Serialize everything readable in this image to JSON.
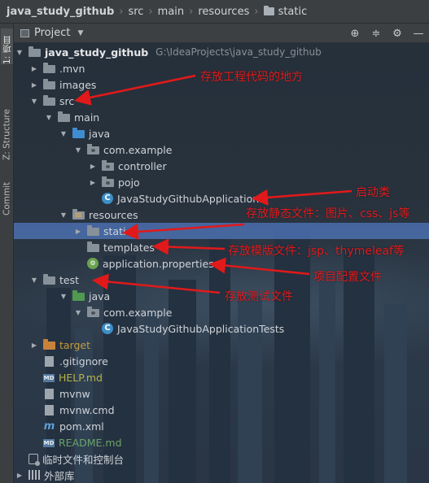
{
  "breadcrumb": [
    {
      "label": "java_study_github",
      "bold": true,
      "icon": "none"
    },
    {
      "label": "src",
      "icon": "none"
    },
    {
      "label": "main",
      "icon": "none"
    },
    {
      "label": "resources",
      "icon": "none"
    },
    {
      "label": "static",
      "icon": "folder-icon"
    }
  ],
  "sidebar": {
    "tabs": [
      "1: 项目",
      "Z: Structure",
      "Commit"
    ]
  },
  "panel": {
    "title": "Project",
    "tools": [
      "locate-icon",
      "collapse-icon",
      "gear-icon",
      "hide-icon"
    ]
  },
  "tree": [
    {
      "label": "java_study_github",
      "hint": "G:\\IdeaProjects\\java_study_github",
      "arrow": "open",
      "icon": "module",
      "style": "bold"
    },
    {
      "label": ".mvn",
      "arrow": "closed",
      "icon": "folder"
    },
    {
      "label": "images",
      "arrow": "closed",
      "icon": "folder"
    },
    {
      "label": "src",
      "arrow": "open",
      "icon": "folder"
    },
    {
      "label": "main",
      "arrow": "open",
      "icon": "folder"
    },
    {
      "label": "java",
      "arrow": "open",
      "icon": "folder-blue"
    },
    {
      "label": "com.example",
      "arrow": "open",
      "icon": "package"
    },
    {
      "label": "controller",
      "arrow": "closed",
      "icon": "package"
    },
    {
      "label": "pojo",
      "arrow": "closed",
      "icon": "package"
    },
    {
      "label": "JavaStudyGithubApplication",
      "arrow": "none",
      "icon": "class"
    },
    {
      "label": "resources",
      "arrow": "open",
      "icon": "folder-resources"
    },
    {
      "label": "static",
      "arrow": "closed",
      "icon": "folder",
      "selected": true
    },
    {
      "label": "templates",
      "arrow": "none",
      "icon": "folder"
    },
    {
      "label": "application.properties",
      "arrow": "none",
      "icon": "properties"
    },
    {
      "label": "test",
      "arrow": "open",
      "icon": "folder"
    },
    {
      "label": "java",
      "arrow": "open",
      "icon": "folder-green"
    },
    {
      "label": "com.example",
      "arrow": "open",
      "icon": "package"
    },
    {
      "label": "JavaStudyGithubApplicationTests",
      "arrow": "none",
      "icon": "class"
    },
    {
      "label": "target",
      "arrow": "closed",
      "icon": "folder-orange",
      "style": "excluded"
    },
    {
      "label": ".gitignore",
      "arrow": "none",
      "icon": "file"
    },
    {
      "label": "HELP.md",
      "arrow": "none",
      "icon": "md",
      "style": "ignored"
    },
    {
      "label": "mvnw",
      "arrow": "none",
      "icon": "file"
    },
    {
      "label": "mvnw.cmd",
      "arrow": "none",
      "icon": "file"
    },
    {
      "label": "pom.xml",
      "arrow": "none",
      "icon": "maven"
    },
    {
      "label": "README.md",
      "arrow": "none",
      "icon": "md",
      "style": "new"
    },
    {
      "label": "临时文件和控制台",
      "arrow": "none",
      "icon": "scratch"
    },
    {
      "label": "外部库",
      "arrow": "closed",
      "icon": "library"
    }
  ],
  "annotations": [
    "存放工程代码的地方",
    "启动类",
    "存放静态文件：图片、css、js等",
    "存放模版文件：jsp、thymeleaf等",
    "项目配置文件",
    "存放测试文件"
  ],
  "colors": {
    "annotation": "#e2191a",
    "selection": "#4b6eaf",
    "toolbar": "#3c4043"
  }
}
